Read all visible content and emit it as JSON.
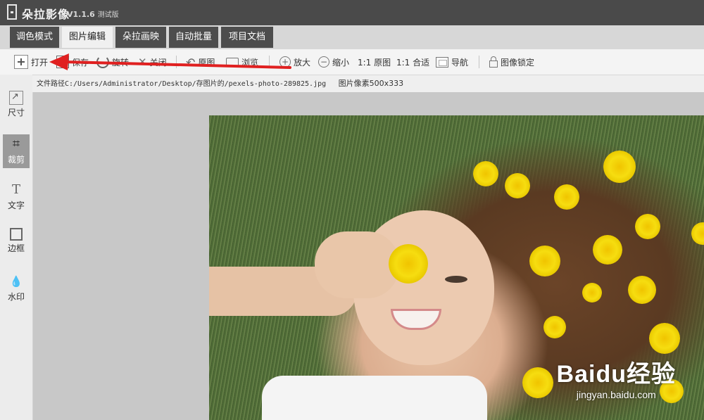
{
  "app": {
    "name": "朵拉影像",
    "version": "V1.1.6",
    "edition": "测试版"
  },
  "tabs": [
    {
      "label": "调色模式",
      "active": false
    },
    {
      "label": "图片编辑",
      "active": true
    },
    {
      "label": "朵拉画映",
      "active": false
    },
    {
      "label": "自动批量",
      "active": false
    },
    {
      "label": "项目文档",
      "active": false
    }
  ],
  "toolbar": {
    "open": "打开",
    "save": "保存",
    "rotate": "旋转",
    "close": "关闭",
    "original": "原图",
    "browse": "浏览",
    "zoom_in": "放大",
    "zoom_out": "缩小",
    "actual_size": "1:1 原图",
    "fit": "1:1 合适",
    "navigate": "导航",
    "lock": "图像锁定"
  },
  "sidebar": [
    {
      "label": "尺寸",
      "icon": "size-icon",
      "active": false
    },
    {
      "label": "裁剪",
      "icon": "crop-icon",
      "active": true
    },
    {
      "label": "文字",
      "icon": "text-icon",
      "active": false
    },
    {
      "label": "边框",
      "icon": "border-icon",
      "active": false
    },
    {
      "label": "水印",
      "icon": "watermark-icon",
      "active": false
    }
  ],
  "pathbar": {
    "path": "文件路径C:/Users/Administrator/Desktop/存图片的/pexels-photo-289825.jpg",
    "pixels": "图片像素500x333"
  },
  "watermark": {
    "logo": "Baidu经验",
    "sub": "jingyan.baidu.com"
  },
  "colors": {
    "titlebar": "#4a4a4a",
    "tab_bg": "#4d4d4d",
    "tab_active": "#f0f0f0",
    "annotation_arrow": "#e02020"
  }
}
